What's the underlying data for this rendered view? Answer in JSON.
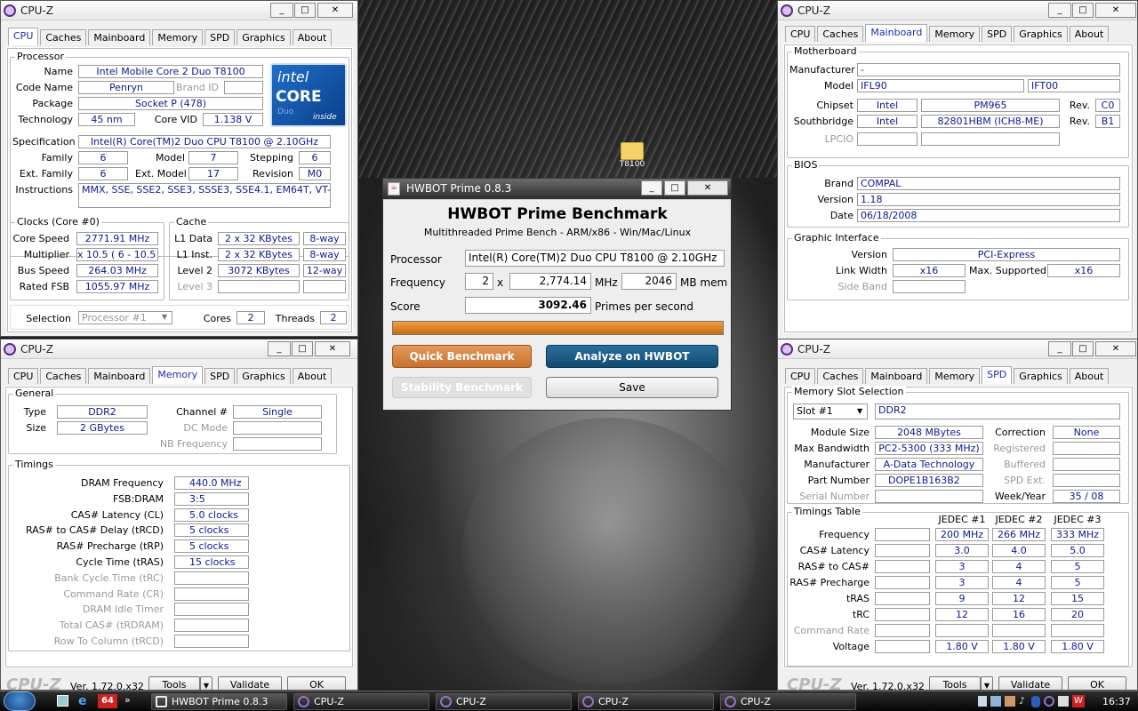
{
  "cpuz_title": "CPU-Z",
  "tabs": [
    "CPU",
    "Caches",
    "Mainboard",
    "Memory",
    "SPD",
    "Graphics",
    "About"
  ],
  "win_buttons": {
    "min": "_",
    "max": "□",
    "close": "✕"
  },
  "cpu": {
    "processor_group": "Processor",
    "name_label": "Name",
    "name": "Intel Mobile Core 2 Duo T8100",
    "codename_label": "Code Name",
    "codename": "Penryn",
    "brandid_label": "Brand ID",
    "package_label": "Package",
    "package": "Socket P (478)",
    "technology_label": "Technology",
    "technology": "45 nm",
    "vid_label": "Core VID",
    "vid": "1.138 V",
    "spec_label": "Specification",
    "spec": "Intel(R) Core(TM)2 Duo CPU     T8100  @ 2.10GHz",
    "family_label": "Family",
    "family": "6",
    "model_label": "Model",
    "model": "7",
    "stepping_label": "Stepping",
    "stepping": "6",
    "extfamily_label": "Ext. Family",
    "extfamily": "6",
    "extmodel_label": "Ext. Model",
    "extmodel": "17",
    "revision_label": "Revision",
    "revision": "M0",
    "instr_label": "Instructions",
    "instr": "MMX, SSE, SSE2, SSE3, SSSE3, SSE4.1, EM64T, VT-x",
    "logo": {
      "line1": "intel",
      "line2": "CORE",
      "line3": "Duo",
      "line4": "inside"
    },
    "clocks_group": "Clocks (Core #0)",
    "corespeed_label": "Core Speed",
    "corespeed": "2771.91 MHz",
    "mult_label": "Multiplier",
    "mult": "x 10.5 ( 6 - 10.5 )",
    "bus_label": "Bus Speed",
    "bus": "264.03 MHz",
    "fsb_label": "Rated FSB",
    "fsb": "1055.97 MHz",
    "cache_group": "Cache",
    "l1d_label": "L1 Data",
    "l1d": "2 x 32 KBytes",
    "l1d_way": "8-way",
    "l1i_label": "L1 Inst.",
    "l1i": "2 x 32 KBytes",
    "l1i_way": "8-way",
    "l2_label": "Level 2",
    "l2": "3072 KBytes",
    "l2_way": "12-way",
    "l3_label": "Level 3",
    "selection_label": "Selection",
    "selection": "Processor #1",
    "cores_label": "Cores",
    "cores": "2",
    "threads_label": "Threads",
    "threads": "2"
  },
  "mem": {
    "general_group": "General",
    "type_label": "Type",
    "type": "DDR2",
    "size_label": "Size",
    "size": "2 GBytes",
    "channel_label": "Channel #",
    "channel": "Single",
    "dc_label": "DC Mode",
    "nb_label": "NB Frequency",
    "timings_group": "Timings",
    "rows": [
      {
        "label": "DRAM Frequency",
        "value": "440.0 MHz"
      },
      {
        "label": "FSB:DRAM",
        "value": "3:5"
      },
      {
        "label": "CAS# Latency (CL)",
        "value": "5.0 clocks"
      },
      {
        "label": "RAS# to CAS# Delay (tRCD)",
        "value": "5 clocks"
      },
      {
        "label": "RAS# Precharge (tRP)",
        "value": "5 clocks"
      },
      {
        "label": "Cycle Time (tRAS)",
        "value": "15 clocks"
      },
      {
        "label": "Bank Cycle Time (tRC)",
        "value": ""
      },
      {
        "label": "Command Rate (CR)",
        "value": ""
      },
      {
        "label": "DRAM Idle Timer",
        "value": ""
      },
      {
        "label": "Total CAS# (tRDRAM)",
        "value": ""
      },
      {
        "label": "Row To Column (tRCD)",
        "value": ""
      }
    ],
    "brand": "CPU-Z",
    "version": "Ver. 1.72.0.x32",
    "tools": "Tools",
    "validate": "Validate",
    "ok": "OK"
  },
  "mb": {
    "group": "Motherboard",
    "manufacturer_label": "Manufacturer",
    "manufacturer": "-",
    "model_label": "Model",
    "model": "IFL90",
    "model2": "IFT00",
    "chipset_label": "Chipset",
    "chipset_vendor": "Intel",
    "chipset": "PM965",
    "rev_label": "Rev.",
    "chipset_rev": "C0",
    "south_label": "Southbridge",
    "south_vendor": "Intel",
    "south": "82801HBM (ICH8-ME)",
    "south_rev": "B1",
    "lpcio_label": "LPCIO",
    "bios_group": "BIOS",
    "brand_label": "Brand",
    "brand": "COMPAL",
    "version_label": "Version",
    "version": "1.18",
    "date_label": "Date",
    "date": "06/18/2008",
    "gi_group": "Graphic Interface",
    "gver_label": "Version",
    "gver": "PCI-Express",
    "lw_label": "Link Width",
    "lw": "x16",
    "ms_label": "Max. Supported",
    "ms": "x16",
    "sb_label": "Side Band"
  },
  "spd": {
    "group": "Memory Slot Selection",
    "slot": "Slot #1",
    "slot_type": "DDR2",
    "modsize_label": "Module Size",
    "modsize": "2048 MBytes",
    "corr_label": "Correction",
    "corr": "None",
    "maxbw_label": "Max Bandwidth",
    "maxbw": "PC2-5300 (333 MHz)",
    "reg_label": "Registered",
    "manuf_label": "Manufacturer",
    "manuf": "A-Data Technology",
    "buf_label": "Buffered",
    "part_label": "Part Number",
    "part": "DOPE1B163B2",
    "spdext_label": "SPD Ext.",
    "serial_label": "Serial Number",
    "week_label": "Week/Year",
    "week": "35 / 08",
    "tt_group": "Timings Table",
    "cols": [
      "JEDEC #1",
      "JEDEC #2",
      "JEDEC #3"
    ],
    "rows": [
      {
        "label": "Frequency",
        "v": [
          "200 MHz",
          "266 MHz",
          "333 MHz"
        ]
      },
      {
        "label": "CAS# Latency",
        "v": [
          "3.0",
          "4.0",
          "5.0"
        ]
      },
      {
        "label": "RAS# to CAS#",
        "v": [
          "3",
          "4",
          "5"
        ]
      },
      {
        "label": "RAS# Precharge",
        "v": [
          "3",
          "4",
          "5"
        ]
      },
      {
        "label": "tRAS",
        "v": [
          "9",
          "12",
          "15"
        ]
      },
      {
        "label": "tRC",
        "v": [
          "12",
          "16",
          "20"
        ]
      },
      {
        "label": "Command Rate",
        "v": [
          "",
          "",
          ""
        ]
      },
      {
        "label": "Voltage",
        "v": [
          "1.80 V",
          "1.80 V",
          "1.80 V"
        ]
      }
    ]
  },
  "hw": {
    "title": "HWBOT Prime 0.8.3",
    "heading": "HWBOT Prime Benchmark",
    "sub": "Multithreaded Prime Bench - ARM/x86 - Win/Mac/Linux",
    "proc_label": "Processor",
    "proc": "Intel(R) Core(TM)2 Duo CPU     T8100  @ 2.10GHz",
    "freq_label": "Frequency",
    "cores": "2",
    "x": "x",
    "freq": "2,774.14",
    "mhz": "MHz",
    "mem": "2046",
    "mem_label": "MB mem",
    "score_label": "Score",
    "score": "3092.46",
    "pps": "Primes per second",
    "progress": 1.0,
    "quick": "Quick Benchmark",
    "analyze": "Analyze on HWBOT",
    "stability": "Stability Benchmark",
    "save": "Save"
  },
  "desktop_icon": "T8100",
  "taskbar": {
    "items": [
      "HWBOT Prime 0.8.3",
      "CPU-Z",
      "CPU-Z",
      "CPU-Z",
      "CPU-Z"
    ],
    "clock": "16:37",
    "quick_num": "64"
  }
}
